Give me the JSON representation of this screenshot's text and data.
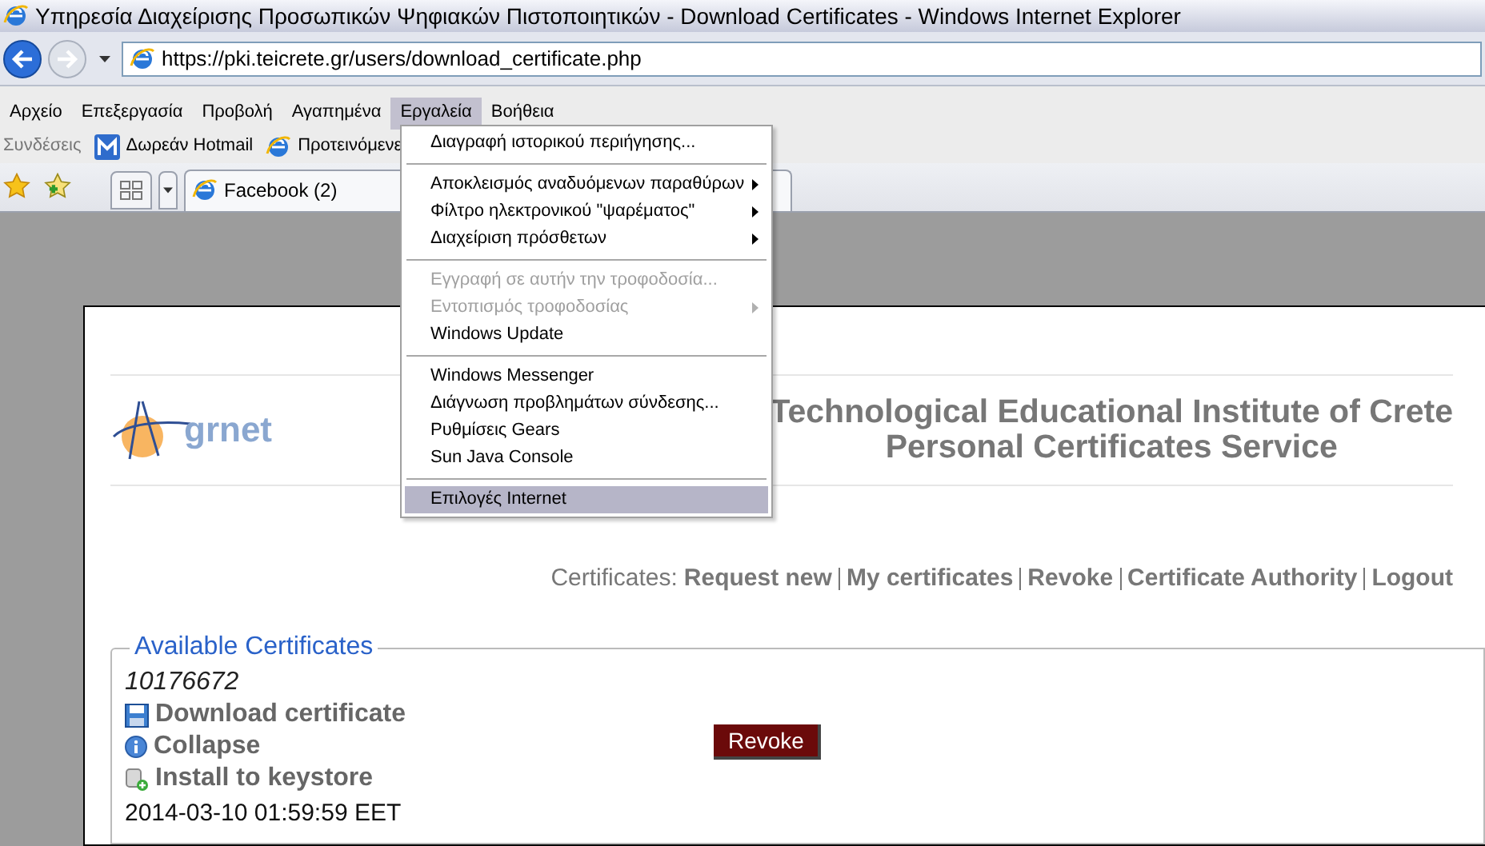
{
  "window": {
    "title": "Υπηρεσία Διαχείρισης Προσωπικών Ψηφιακών Πιστοποιητικών - Download Certificates - Windows Internet Explorer"
  },
  "address_bar": {
    "value": "https://pki.teicrete.gr/users/download_certificate.php"
  },
  "menu_bar": [
    {
      "label": "Αρχείο",
      "selected": false
    },
    {
      "label": "Επεξεργασία",
      "selected": false
    },
    {
      "label": "Προβολή",
      "selected": false
    },
    {
      "label": "Αγαπημένα",
      "selected": false
    },
    {
      "label": "Εργαλεία",
      "selected": true
    },
    {
      "label": "Βοήθεια",
      "selected": false
    }
  ],
  "links_bar": {
    "label": "Συνδέσεις",
    "links": [
      {
        "kind": "hotmail",
        "label": "Δωρεάν Hotmail"
      },
      {
        "kind": "ie",
        "label": "Προτεινόμενε"
      }
    ]
  },
  "tabs": [
    {
      "label": "Facebook (2)",
      "selected": true
    }
  ],
  "tools_menu": {
    "groups": [
      [
        {
          "label": "Διαγραφή ιστορικού περιήγησης...",
          "disabled": false,
          "submenu": false,
          "selected": false
        }
      ],
      [
        {
          "label": "Αποκλεισμός αναδυόμενων παραθύρων",
          "disabled": false,
          "submenu": true,
          "selected": false
        },
        {
          "label": "Φίλτρο ηλεκτρονικού \"ψαρέματος\"",
          "disabled": false,
          "submenu": true,
          "selected": false
        },
        {
          "label": "Διαχείριση πρόσθετων",
          "disabled": false,
          "submenu": true,
          "selected": false
        }
      ],
      [
        {
          "label": "Εγγραφή σε αυτήν την τροφοδοσία...",
          "disabled": true,
          "submenu": false,
          "selected": false
        },
        {
          "label": "Εντοπισμός τροφοδοσίας",
          "disabled": true,
          "submenu": true,
          "selected": false
        },
        {
          "label": "Windows Update",
          "disabled": false,
          "submenu": false,
          "selected": false
        }
      ],
      [
        {
          "label": "Windows Messenger",
          "disabled": false,
          "submenu": false,
          "selected": false
        },
        {
          "label": "Διάγνωση προβλημάτων σύνδεσης...",
          "disabled": false,
          "submenu": false,
          "selected": false
        },
        {
          "label": "Ρυθμίσεις Gears",
          "disabled": false,
          "submenu": false,
          "selected": false
        },
        {
          "label": "Sun Java Console",
          "disabled": false,
          "submenu": false,
          "selected": false
        }
      ],
      [
        {
          "label": "Επιλογές Internet",
          "disabled": false,
          "submenu": false,
          "selected": true
        }
      ]
    ]
  },
  "page": {
    "logo": "grnet",
    "heading": [
      "Technological Educational Institute of Crete",
      "Personal Certificates Service"
    ],
    "nav": {
      "prefix": "Certificates:",
      "links": [
        "Request new",
        "My certificates",
        "Revoke",
        "Certificate Authority",
        "Logout"
      ]
    },
    "certificates": {
      "legend": "Available Certificates",
      "id": "10176672",
      "actions": [
        {
          "kind": "download",
          "label": "Download certificate"
        },
        {
          "kind": "info",
          "label": "Collapse"
        },
        {
          "kind": "install",
          "label": "Install to keystore"
        }
      ],
      "revoke_button": "Revoke",
      "date": "2014-03-10 01:59:59 EET"
    }
  }
}
